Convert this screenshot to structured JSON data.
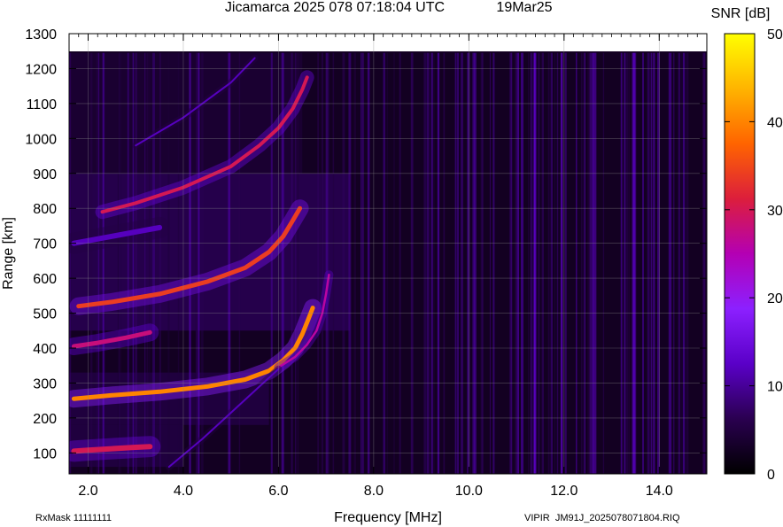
{
  "chart_data": {
    "type": "heatmap",
    "title": "Jicamarca 2025 078 07:18:04 UTC",
    "date_label": "19Mar25",
    "xlabel": "Frequency [MHz]",
    "ylabel": "Range [km]",
    "colorbar_label": "SNR [dB]",
    "xlim": [
      1.6,
      15.0
    ],
    "ylim": [
      40,
      1300
    ],
    "data_ymax": 1245,
    "clim": [
      0,
      50
    ],
    "x_ticks": [
      2.0,
      4.0,
      6.0,
      8.0,
      10.0,
      12.0,
      14.0
    ],
    "x_tick_labels": [
      "2.0",
      "4.0",
      "6.0",
      "8.0",
      "10.0",
      "12.0",
      "14.0"
    ],
    "y_ticks": [
      100,
      200,
      300,
      400,
      500,
      600,
      700,
      800,
      900,
      1000,
      1100,
      1200,
      1300
    ],
    "y_tick_labels": [
      "100",
      "200",
      "300",
      "400",
      "500",
      "600",
      "700",
      "800",
      "900",
      "1000",
      "1100",
      "1200",
      "1300"
    ],
    "colorbar_ticks": [
      0,
      10,
      20,
      30,
      40,
      50
    ],
    "colorbar_tick_labels": [
      "0",
      "10",
      "20",
      "30",
      "40",
      "50"
    ],
    "colormap": [
      "#000000",
      "#2a0050",
      "#5a00c8",
      "#8c20ff",
      "#b400b4",
      "#dc1e3c",
      "#ff6400",
      "#ffb400",
      "#ffff00"
    ],
    "grid": true,
    "footer_left": "RxMask 11111111",
    "footer_right": "VIPIR  JM91J_2025078071804.RIQ",
    "traces": [
      {
        "name": "trace-o-F",
        "x": [
          1.7,
          2.5,
          3.5,
          4.5,
          5.3,
          5.8,
          6.1,
          6.35,
          6.5,
          6.62,
          6.72
        ],
        "y": [
          255,
          265,
          275,
          290,
          310,
          335,
          365,
          400,
          440,
          480,
          515
        ],
        "snr": 40,
        "width": 5
      },
      {
        "name": "trace-x-F",
        "x": [
          6.0,
          6.35,
          6.6,
          6.8,
          6.92,
          7.0,
          7.06
        ],
        "y": [
          345,
          375,
          410,
          450,
          500,
          555,
          610
        ],
        "snr": 26,
        "width": 2.5
      },
      {
        "name": "trace-o-2hop",
        "x": [
          1.8,
          2.5,
          3.5,
          4.5,
          5.3,
          5.8,
          6.1,
          6.3,
          6.45
        ],
        "y": [
          520,
          532,
          555,
          590,
          630,
          675,
          720,
          765,
          800
        ],
        "snr": 34,
        "width": 5
      },
      {
        "name": "trace-o-3hop",
        "x": [
          2.3,
          3.0,
          4.0,
          5.0,
          5.6,
          6.0,
          6.3,
          6.5,
          6.6
        ],
        "y": [
          790,
          815,
          860,
          920,
          980,
          1030,
          1085,
          1140,
          1175
        ],
        "snr": 30,
        "width": 4
      },
      {
        "name": "trace-Es-400",
        "x": [
          1.7,
          2.2,
          2.8,
          3.3
        ],
        "y": [
          405,
          415,
          430,
          445
        ],
        "snr": 28,
        "width": 5
      },
      {
        "name": "trace-E-100",
        "x": [
          1.7,
          2.0,
          2.5,
          3.0,
          3.3
        ],
        "y": [
          105,
          108,
          112,
          116,
          118
        ],
        "snr": 30,
        "width": 6
      },
      {
        "name": "trace-sweep-diag",
        "x": [
          3.7,
          4.4,
          5.0,
          5.6,
          6.0
        ],
        "y": [
          60,
          140,
          215,
          290,
          340
        ],
        "snr": 12,
        "width": 2
      },
      {
        "name": "trace-faint-1250",
        "x": [
          3.0,
          4.0,
          5.0,
          5.5
        ],
        "y": [
          980,
          1060,
          1160,
          1230
        ],
        "snr": 12,
        "width": 2
      },
      {
        "name": "trace-faint-700",
        "x": [
          1.7,
          2.5,
          3.5
        ],
        "y": [
          700,
          720,
          745
        ],
        "snr": 12,
        "width": 6
      }
    ],
    "noise_regions": [
      {
        "name": "region-F-diffuse",
        "x": [
          1.6,
          7.5
        ],
        "y": [
          450,
          900
        ],
        "snr": 10
      },
      {
        "name": "region-low-F",
        "x": [
          1.6,
          5.8
        ],
        "y": [
          180,
          330
        ],
        "snr": 8
      },
      {
        "name": "region-lower-E",
        "x": [
          1.6,
          4.0
        ],
        "y": [
          60,
          180
        ],
        "snr": 8
      },
      {
        "name": "region-upper",
        "x": [
          1.6,
          6.5
        ],
        "y": [
          900,
          1245
        ],
        "snr": 6
      }
    ]
  }
}
